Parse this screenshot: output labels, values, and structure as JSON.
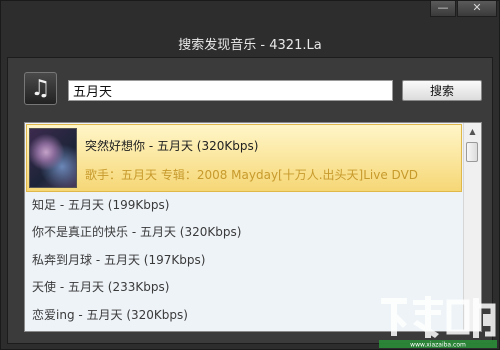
{
  "window": {
    "title": "搜索发现音乐 - 4321.La",
    "controls": {
      "minimize": "—",
      "close": "✕"
    }
  },
  "toolbar": {
    "music_icon": "music-note-icon",
    "search_value": "五月天",
    "search_label": "搜索"
  },
  "results": {
    "featured": {
      "title": "突然好想你 - 五月天 (320Kbps)",
      "subtitle": "歌手：五月天 专辑：2008 Mayday[十万人.出头天]Live DVD",
      "cover_icon": "album-cover"
    },
    "items": [
      "知足 - 五月天 (199Kbps)",
      "你不是真正的快乐 - 五月天 (320Kbps)",
      "私奔到月球 - 五月天 (197Kbps)",
      "天使 - 五月天 (233Kbps)",
      "恋爱ing - 五月天 (320Kbps)"
    ]
  },
  "watermark": {
    "main": "下载吧",
    "sub": "www.xiazaiba.com"
  },
  "colors": {
    "window_bg": "#2d2d2d",
    "highlight_top": "#fff6c8",
    "highlight_bottom": "#f6d776",
    "subtitle": "#c79a2c",
    "list_bg": "#eef3f8"
  }
}
